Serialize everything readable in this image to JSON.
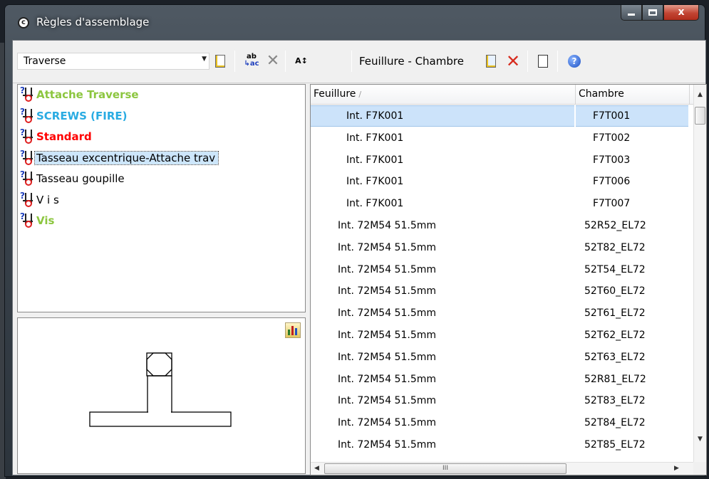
{
  "window": {
    "title": "Règles d'assemblage",
    "icon": "app-c-icon",
    "close_glyph": "x"
  },
  "toolbar": {
    "profile_combo_value": "Traverse",
    "rule_section_label": "Feuillure - Chambre",
    "icons": [
      "new-document-icon",
      "rename-icon",
      "delete-icon",
      "sort-icon",
      "add-row-icon",
      "delete-red-icon",
      "properties-icon",
      "help-icon"
    ]
  },
  "rules": {
    "items": [
      {
        "label": "Attache Traverse",
        "color": "#8cc63f",
        "bold": true
      },
      {
        "label": "SCREWS (FIRE)",
        "color": "#29abe2",
        "bold": true
      },
      {
        "label": "Standard",
        "color": "#ff0000",
        "bold": true
      },
      {
        "label": "Tasseau excentrique-Attache trav",
        "color": "#000000",
        "bold": false,
        "selected": true
      },
      {
        "label": "Tasseau goupille",
        "color": "#000000",
        "bold": false
      },
      {
        "label": "V i s",
        "color": "#000000",
        "bold": false
      },
      {
        "label": "Vis",
        "color": "#8cc63f",
        "bold": true
      }
    ]
  },
  "grid": {
    "columns": [
      "Feuillure",
      "Chambre"
    ],
    "rows": [
      [
        "Int. F7K001",
        "F7T001"
      ],
      [
        "Int. F7K001",
        "F7T002"
      ],
      [
        "Int. F7K001",
        "F7T003"
      ],
      [
        "Int. F7K001",
        "F7T006"
      ],
      [
        "Int. F7K001",
        "F7T007"
      ],
      [
        "Int. 72M54 51.5mm",
        "52R52_EL72"
      ],
      [
        "Int. 72M54 51.5mm",
        "52T82_EL72"
      ],
      [
        "Int. 72M54 51.5mm",
        "52T54_EL72"
      ],
      [
        "Int. 72M54 51.5mm",
        "52T60_EL72"
      ],
      [
        "Int. 72M54 51.5mm",
        "52T61_EL72"
      ],
      [
        "Int. 72M54 51.5mm",
        "52T62_EL72"
      ],
      [
        "Int. 72M54 51.5mm",
        "52T63_EL72"
      ],
      [
        "Int. 72M54 51.5mm",
        "52R81_EL72"
      ],
      [
        "Int. 72M54 51.5mm",
        "52T83_EL72"
      ],
      [
        "Int. 72M54 51.5mm",
        "52T84_EL72"
      ],
      [
        "Int. 72M54 51.5mm",
        "52T85_EL72"
      ]
    ],
    "selected_row": 0,
    "hscroll_thumb_glyph": "III"
  },
  "colors": {
    "selection": "#cce3fa",
    "accent_help": "#1b4fc2"
  }
}
